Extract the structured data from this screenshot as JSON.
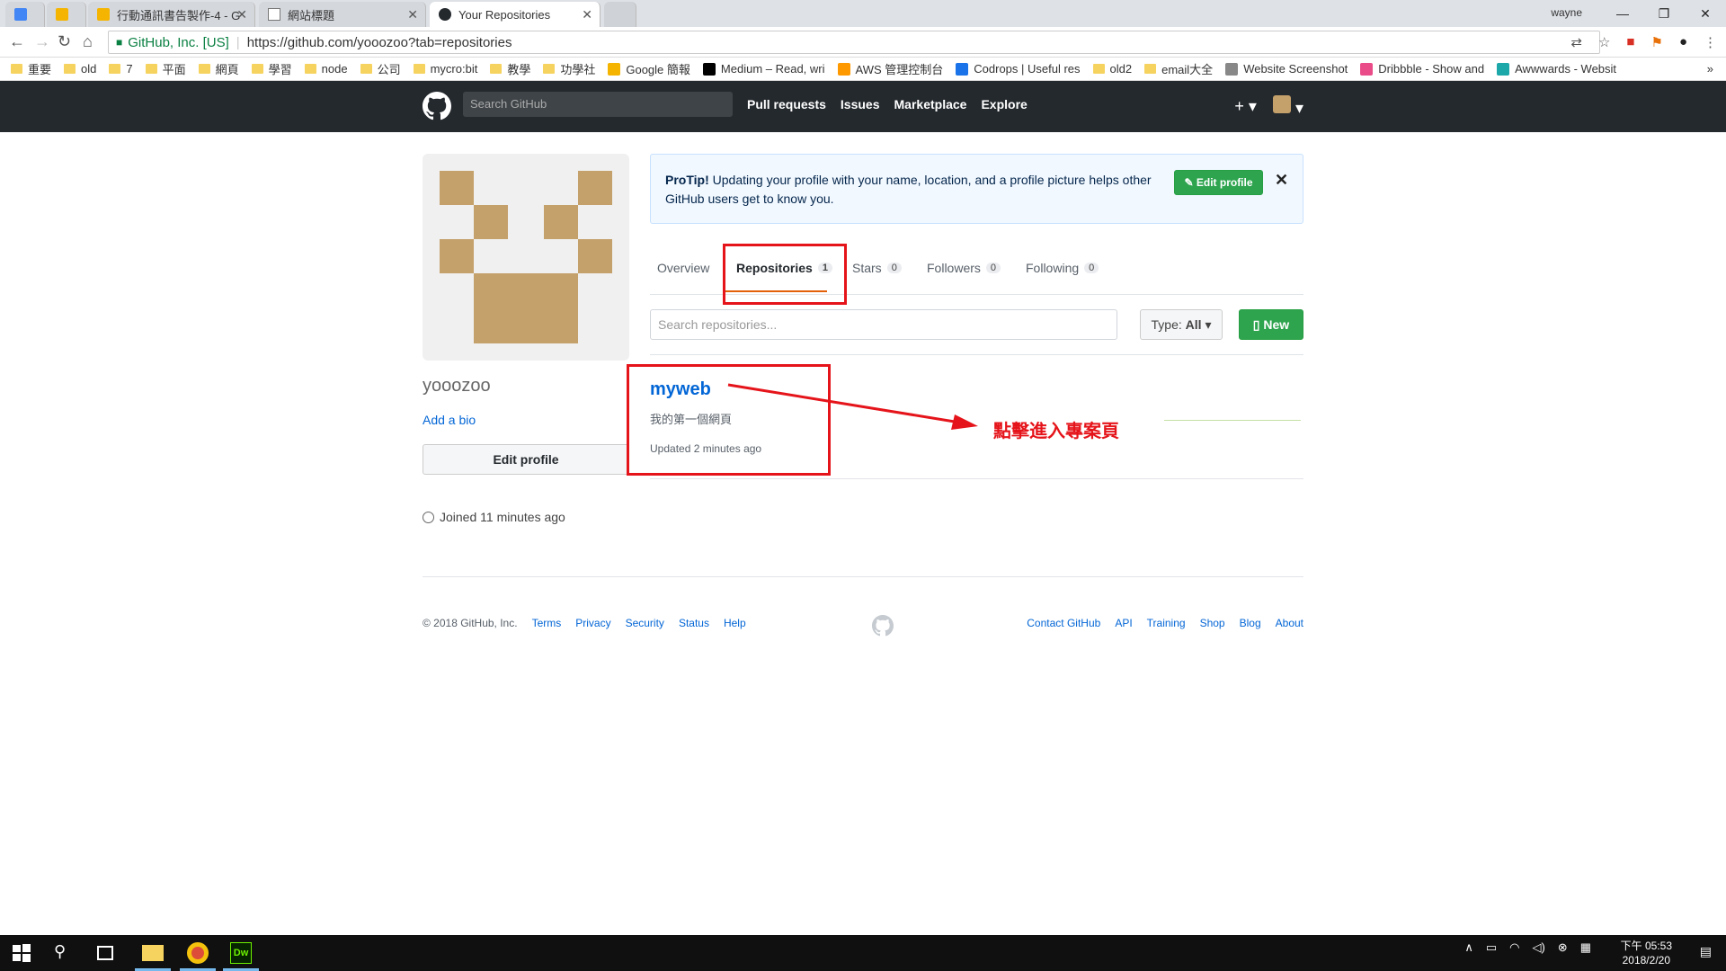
{
  "browser": {
    "tabs": [
      {
        "label": ""
      },
      {
        "label": ""
      },
      {
        "label": "行動通訊書告製作-4 - G"
      },
      {
        "label": "網站標題"
      },
      {
        "label": "Your Repositories"
      }
    ],
    "window_user": "wayne",
    "secure_label": "GitHub, Inc. [US]",
    "url": "https://github.com/yooozoo?tab=repositories",
    "bookmarks": [
      {
        "label": "重要",
        "kind": "folder"
      },
      {
        "label": "old",
        "kind": "folder"
      },
      {
        "label": "7",
        "kind": "folder"
      },
      {
        "label": "平面",
        "kind": "folder"
      },
      {
        "label": "網頁",
        "kind": "folder"
      },
      {
        "label": "學習",
        "kind": "folder"
      },
      {
        "label": "node",
        "kind": "folder"
      },
      {
        "label": "公司",
        "kind": "folder"
      },
      {
        "label": "mycro:bit",
        "kind": "folder"
      },
      {
        "label": "教學",
        "kind": "folder"
      },
      {
        "label": "功學社",
        "kind": "folder"
      },
      {
        "label": "Google 簡報",
        "kind": "site"
      },
      {
        "label": "Medium – Read, wri",
        "kind": "site"
      },
      {
        "label": "AWS 管理控制台",
        "kind": "site"
      },
      {
        "label": "Codrops | Useful res",
        "kind": "site"
      },
      {
        "label": "old2",
        "kind": "folder"
      },
      {
        "label": "email大全",
        "kind": "folder"
      },
      {
        "label": "Website Screenshot",
        "kind": "site"
      },
      {
        "label": "Dribbble - Show and",
        "kind": "site"
      },
      {
        "label": "Awwwards - Websit",
        "kind": "site"
      }
    ]
  },
  "github": {
    "search_placeholder": "Search GitHub",
    "nav": [
      "Pull requests",
      "Issues",
      "Marketplace",
      "Explore"
    ],
    "username": "yooozoo",
    "add_bio": "Add a bio",
    "edit_profile": "Edit profile",
    "joined": "Joined 11 minutes ago",
    "protip_bold": "ProTip!",
    "protip_text": " Updating your profile with your name, location, and a profile picture helps other GitHub users get to know you.",
    "protip_button": "Edit profile",
    "tabs": [
      {
        "label": "Overview",
        "count": ""
      },
      {
        "label": "Repositories",
        "count": "1"
      },
      {
        "label": "Stars",
        "count": "0"
      },
      {
        "label": "Followers",
        "count": "0"
      },
      {
        "label": "Following",
        "count": "0"
      }
    ],
    "search_repos_placeholder": "Search repositories...",
    "type_label": "Type:",
    "type_value": "All",
    "new_button": "New",
    "repo": {
      "name": "myweb",
      "description": "我的第一個網頁",
      "updated": "Updated 2 minutes ago"
    },
    "annotation": "點擊進入專案頁",
    "footer_left": [
      "© 2018 GitHub, Inc.",
      "Terms",
      "Privacy",
      "Security",
      "Status",
      "Help"
    ],
    "footer_right": [
      "Contact GitHub",
      "API",
      "Training",
      "Shop",
      "Blog",
      "About"
    ]
  },
  "taskbar": {
    "time": "下午 05:53",
    "date": "2018/2/20"
  },
  "colors": {
    "annotation_red": "#e5141a",
    "github_header": "#24292e",
    "link_blue": "#0366d6",
    "primary_green": "#2ea44f",
    "avatar_tan": "#c4a06a"
  }
}
